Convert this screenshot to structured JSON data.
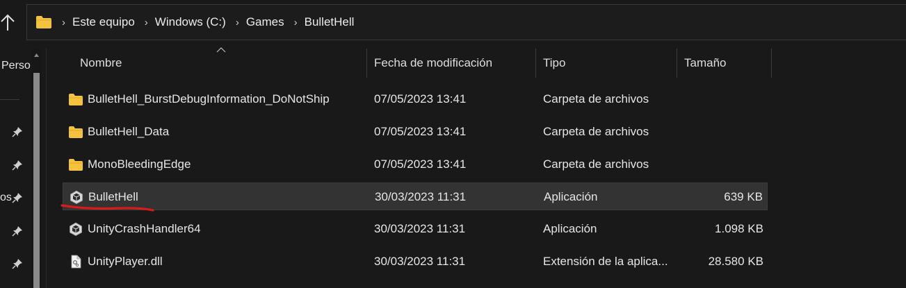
{
  "address": {
    "crumbs": [
      "Este equipo",
      "Windows (C:)",
      "Games",
      "BulletHell"
    ],
    "separator": "›"
  },
  "nav": {
    "item_top": "Perso",
    "item_mid": "os"
  },
  "columns": {
    "name": "Nombre",
    "date": "Fecha de modificación",
    "type": "Tipo",
    "size": "Tamaño"
  },
  "files": [
    {
      "name": "BulletHell_BurstDebugInformation_DoNotShip",
      "date": "07/05/2023 13:41",
      "type": "Carpeta de archivos",
      "size": "",
      "icon": "folder-icon"
    },
    {
      "name": "BulletHell_Data",
      "date": "07/05/2023 13:41",
      "type": "Carpeta de archivos",
      "size": "",
      "icon": "folder-icon"
    },
    {
      "name": "MonoBleedingEdge",
      "date": "07/05/2023 13:41",
      "type": "Carpeta de archivos",
      "size": "",
      "icon": "folder-icon"
    },
    {
      "name": "BulletHell",
      "date": "30/03/2023 11:31",
      "type": "Aplicación",
      "size": "639 KB",
      "icon": "unity-app-icon"
    },
    {
      "name": "UnityCrashHandler64",
      "date": "30/03/2023 11:31",
      "type": "Aplicación",
      "size": "1.098 KB",
      "icon": "unity-app-icon"
    },
    {
      "name": "UnityPlayer.dll",
      "date": "30/03/2023 11:31",
      "type": "Extensión de la aplica...",
      "size": "28.580 KB",
      "icon": "dll-file-icon"
    }
  ],
  "colors": {
    "background": "#191919",
    "selected_row": "#333333",
    "folder": "#f3c340",
    "annotation_underline": "#d81b1b"
  }
}
